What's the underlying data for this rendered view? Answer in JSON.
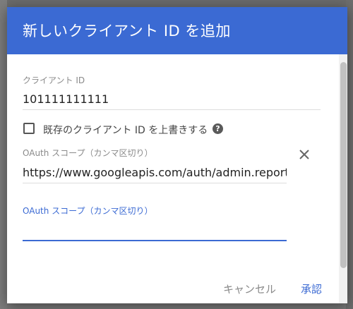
{
  "dialog": {
    "title": "新しいクライアント ID を追加"
  },
  "client_id": {
    "label": "クライアント ID",
    "value": "101111111111"
  },
  "overwrite": {
    "label": "既存のクライアント ID を上書きする",
    "checked": false,
    "help_icon": "help-circle-icon",
    "help_glyph": "?"
  },
  "scope1": {
    "label": "OAuth スコープ（カンマ区切り）",
    "value": "https://www.googleapis.com/auth/admin.reports",
    "remove_icon": "close-icon"
  },
  "scope2": {
    "label": "OAuth スコープ（カンマ区切り）",
    "value": ""
  },
  "actions": {
    "cancel_label": "キャンセル",
    "approve_label": "承認"
  },
  "colors": {
    "header": "#3b6ad3",
    "accent": "#3b6ad3",
    "backdrop": "#7a7a7a"
  }
}
